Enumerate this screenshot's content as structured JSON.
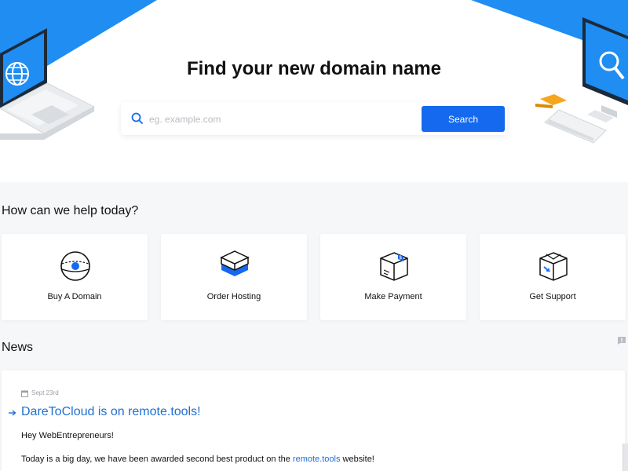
{
  "hero": {
    "title": "Find your new domain name",
    "search": {
      "placeholder": "eg. example.com",
      "value": "",
      "button_label": "Search"
    },
    "accent_color": "#1f8df2"
  },
  "help": {
    "heading": "How can we help today?",
    "cards": [
      {
        "label": "Buy A Domain",
        "icon": "globe-icon"
      },
      {
        "label": "Order Hosting",
        "icon": "hosting-stack-icon"
      },
      {
        "label": "Make Payment",
        "icon": "payment-box-icon"
      },
      {
        "label": "Get Support",
        "icon": "support-box-icon"
      }
    ]
  },
  "news": {
    "heading": "News",
    "items": [
      {
        "date": "Sept 23rd",
        "title": "DareToCloud is on remote.tools!",
        "greeting": "Hey WebEntrepreneurs!",
        "body_prefix": "Today is a big day, we have been awarded second best product on the ",
        "body_link": "remote.tools",
        "body_suffix": " website!"
      }
    ]
  },
  "colors": {
    "primary_button": "#1469ef",
    "link": "#1f6fd1",
    "page_background": "#f6f7f9"
  }
}
